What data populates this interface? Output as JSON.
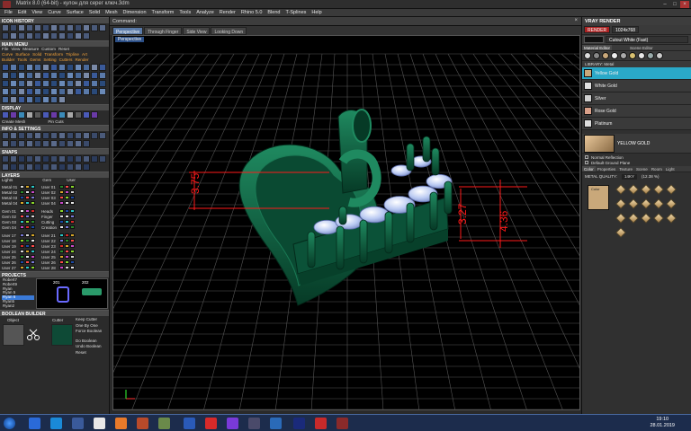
{
  "titlebar": {
    "title": "Matrix 8.0 (64-bit) - кулон для серег ключ.3dm"
  },
  "menu": [
    "File",
    "Edit",
    "View",
    "Curve",
    "Surface",
    "Solid",
    "Mesh",
    "Dimension",
    "Transform",
    "Tools",
    "Analyze",
    "Render",
    "Rhino 5.0",
    "Blend",
    "T-Splines",
    "Help"
  ],
  "left": {
    "icon_history": "ICON HISTORY",
    "main_menu": "MAIN MENU",
    "main_sub1": [
      "File",
      "View",
      "Measure",
      "Custom",
      "Reset"
    ],
    "main_sub2": [
      "Curve",
      "Surface",
      "Solid",
      "Transform",
      "Tripline",
      "Art"
    ],
    "main_sub3": [
      "Builder",
      "Tools",
      "Gems",
      "Setting",
      "Cutters",
      "Render"
    ],
    "display": "DISPLAY",
    "display_sub": [
      "Create Mesh",
      "Pin Cuts"
    ],
    "info": "INFO & SETTINGS",
    "snaps": "SNAPS",
    "layers": "LAYERS",
    "layers_header": [
      "Lights",
      "Gem",
      "User"
    ],
    "layer_rows": [
      [
        "Metal 01",
        "User 01"
      ],
      [
        "Metal 02",
        "User 02"
      ],
      [
        "Metal 03",
        "User 03"
      ],
      [
        "Metal 04",
        "User 04"
      ],
      [
        "Gem 01",
        "Heads"
      ],
      [
        "Gem 02",
        "Finger"
      ],
      [
        "Gem 03",
        "Cutting"
      ],
      [
        "Gem 04",
        "Creation"
      ],
      [
        "User 17",
        "User 21"
      ],
      [
        "User 18",
        "User 22"
      ],
      [
        "User 19",
        "User 23"
      ],
      [
        "User 24",
        "User 24"
      ],
      [
        "User 25",
        "User 25"
      ],
      [
        "User 26",
        "User 26"
      ],
      [
        "User 27",
        "User 28"
      ]
    ],
    "projects": "PROJECTS",
    "project_items": [
      "Robert7",
      "Robert9",
      "Ryan",
      "Ryan 5",
      "Ryan 6",
      "Ryan5",
      "Ryan2"
    ],
    "project_nums": [
      "201",
      "202"
    ],
    "boolean": "BOOLEAN BUILDER",
    "boolean_labels": [
      "Object",
      "Cutter"
    ],
    "boolean_options": [
      "Keep Cutter",
      "One By One",
      "Force Boolean",
      "Do Boolean",
      "Undo Boolean",
      "Reset"
    ]
  },
  "viewport": {
    "command": "Command:",
    "tabs": [
      "Perspective",
      "Through Finger",
      "Side View",
      "Looking Down"
    ],
    "label": "Perspective",
    "dims": [
      "3.75",
      "3.27",
      "4.36"
    ]
  },
  "right": {
    "title": "VRAY RENDER",
    "render_btn": "RENDER",
    "res": "1024x768",
    "preset": "Cutout White (Fast)",
    "tabs1": [
      "Material Editor",
      "Scene Editor"
    ],
    "library": "LIBRARY: Metal",
    "materials": [
      "Yellow Gold",
      "White Gold",
      "Silver",
      "Rose Gold",
      "Platinum"
    ],
    "selected_name": "YELLOW GOLD",
    "props": [
      "Normal Reflection",
      "Default Ground Plane"
    ],
    "tabs2": [
      "Color",
      "Properties",
      "Texture",
      "Scene",
      "Room",
      "Light"
    ],
    "metal_quality": "METAL QUALITY:",
    "karat": "14KY",
    "karat_value": "(12.38 %)",
    "color_label": "Color"
  },
  "taskbar": {
    "time": "19:10",
    "date": "28.01.2019"
  },
  "colors": {
    "selected_material": "#2aa9c8",
    "model": "#0d5c3e",
    "gem": "#c8d8f8",
    "dim": "#ff1a1a",
    "grid": "#555555"
  }
}
